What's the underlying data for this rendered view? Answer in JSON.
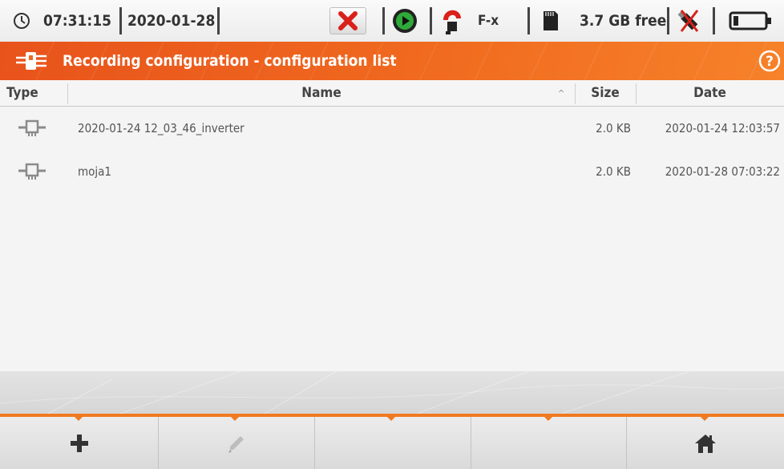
{
  "status": {
    "time": "07:31:15",
    "date": "2020-01-28",
    "probe_label": "F-x",
    "storage_free": "3.7 GB free"
  },
  "header": {
    "title": "Recording configuration - configuration list"
  },
  "table": {
    "columns": [
      "Type",
      "Name",
      "Size",
      "Date"
    ],
    "sort_indicator": "^",
    "rows": [
      {
        "type_icon": "config-file-icon",
        "name": "2020-01-24 12_03_46_inverter",
        "size": "2.0 KB",
        "date": "2020-01-24 12:03:57"
      },
      {
        "type_icon": "config-file-icon",
        "name": "moja1",
        "size": "2.0 KB",
        "date": "2020-01-28 07:03:22"
      }
    ]
  },
  "footer": {
    "buttons": [
      "add-icon",
      "edit-icon",
      "",
      "",
      "home-icon"
    ]
  },
  "colors": {
    "accent": "#f06a1f",
    "close_red": "#d9201a",
    "play_green": "#2eaa3a"
  }
}
